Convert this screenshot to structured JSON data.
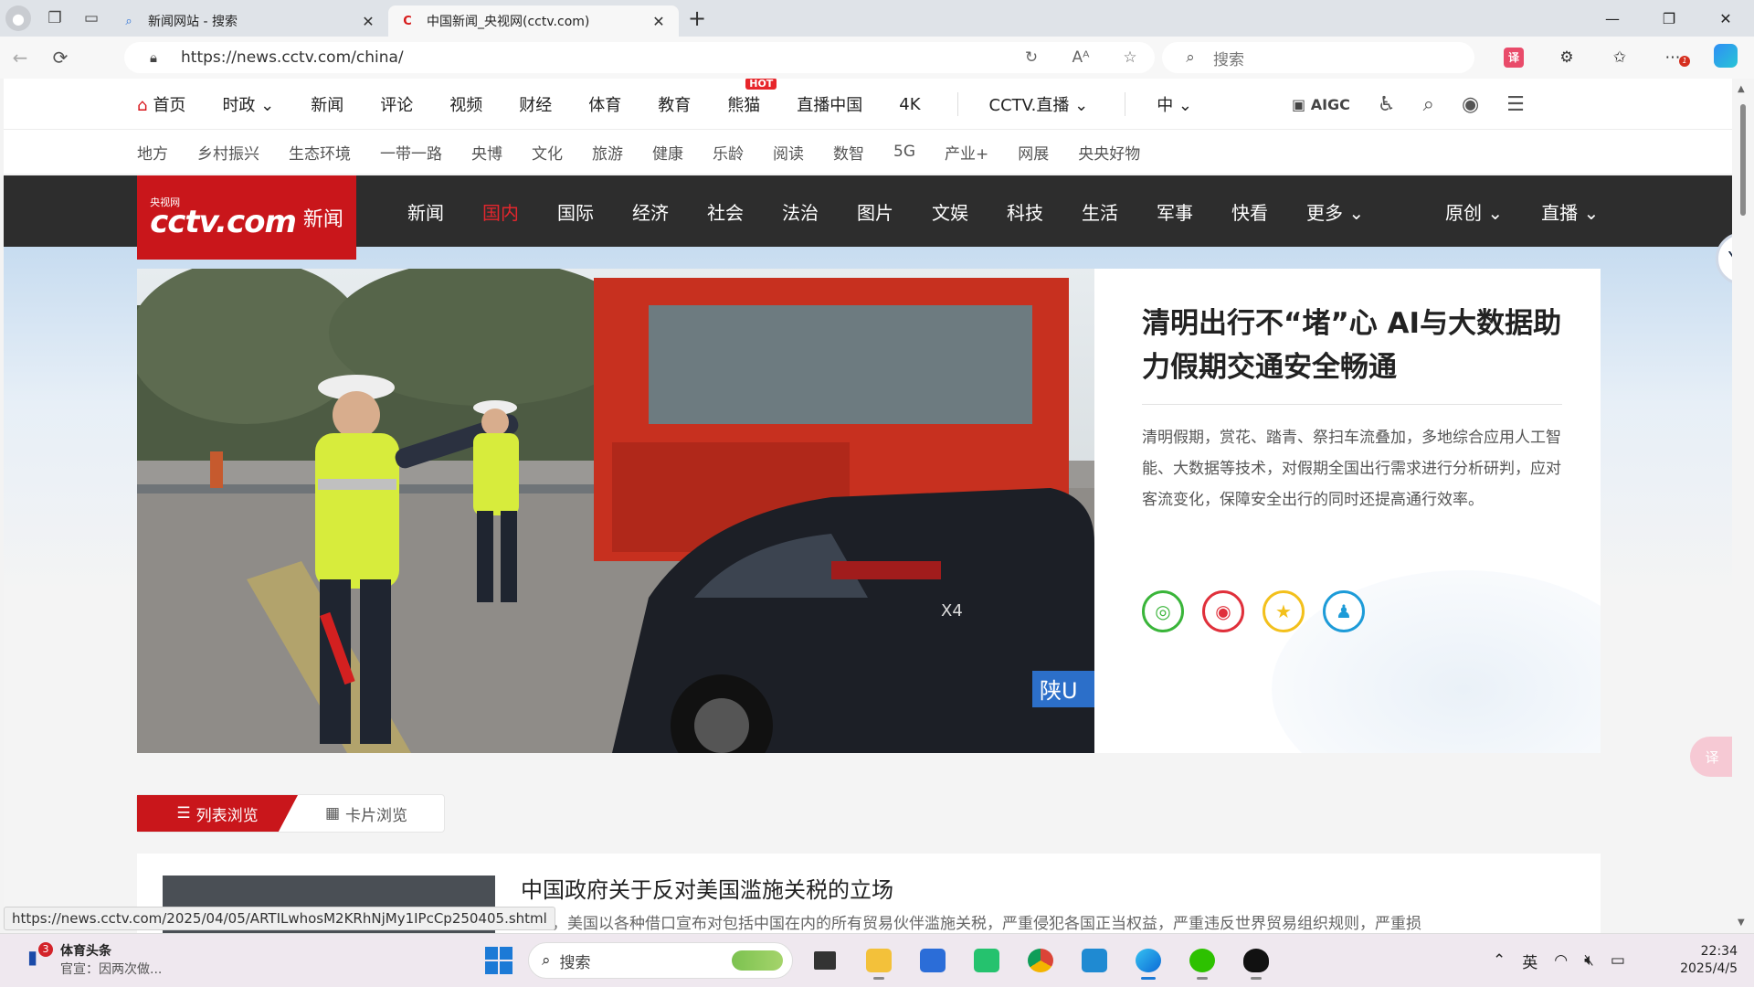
{
  "browser": {
    "tabs": [
      {
        "title": "新闻网站 - 搜索",
        "active": false
      },
      {
        "title": "中国新闻_央视网(cctv.com)",
        "active": true
      }
    ],
    "url": "https://news.cctv.com/china/",
    "search_placeholder": "搜索",
    "translate_label": "译",
    "notif_count": "1",
    "status_url": "https://news.cctv.com/2025/04/05/ARTILwhosM2KRhNjMy1IPcCp250405.shtml"
  },
  "topnav": {
    "items": [
      "首页",
      "时政",
      "新闻",
      "评论",
      "视频",
      "财经",
      "体育",
      "教育",
      "熊猫",
      "直播中国",
      "4K"
    ],
    "hot_badge": "HOT",
    "live": "CCTV.直播",
    "lang": "中",
    "aigc": "AIGC"
  },
  "subnav": {
    "items": [
      "地方",
      "乡村振兴",
      "生态环境",
      "一带一路",
      "央博",
      "文化",
      "旅游",
      "健康",
      "乐龄",
      "阅读",
      "数智",
      "5G",
      "产业+",
      "网展",
      "央央好物"
    ]
  },
  "channel": {
    "logo_brand": "cctv.com",
    "logo_small": "央视网",
    "logo_news": "新闻",
    "items": [
      "新闻",
      "国内",
      "国际",
      "经济",
      "社会",
      "法治",
      "图片",
      "文娱",
      "科技",
      "生活",
      "军事",
      "快看",
      "更多 ⌄"
    ],
    "active": "国内",
    "right": [
      "原创 ⌄",
      "直播 ⌄"
    ]
  },
  "hero": {
    "title": "清明出行不“堵”心 AI与大数据助力假期交通安全畅通",
    "description": "清明假期，赏花、踏青、祭扫车流叠加，多地综合应用人工智能、大数据等技术，对假期全国出行需求进行分析研判，应对客流变化，保障安全出行的同时还提高通行效率。",
    "plate_text": "陕U",
    "car_badge": "X4"
  },
  "view_toggle": {
    "list": "列表浏览",
    "card": "卡片浏览"
  },
  "list": [
    {
      "title": "中国政府关于反对美国滥施关税的立场",
      "summary": "近期，美国以各种借口宣布对包括中国在内的所有贸易伙伴滥施关税，严重侵犯各国正当权益，严重违反世界贸易组织规则，严重损"
    }
  ],
  "taskbar": {
    "news_title": "体育头条",
    "news_sub": "官宣：因两次做...",
    "news_badge": "3",
    "search_placeholder": "搜索",
    "ime": "英",
    "time": "22:34",
    "date": "2025/4/5"
  },
  "colors": {
    "brand_red": "#c9161b",
    "dark_nav": "#2d2d2d",
    "active_channel": "#e3262d"
  }
}
